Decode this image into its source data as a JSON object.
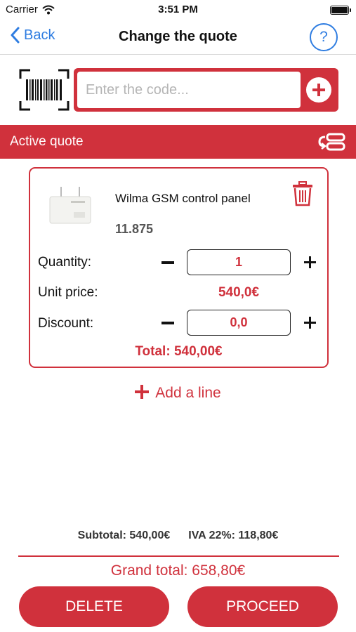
{
  "status_bar": {
    "carrier": "Carrier",
    "time": "3:51 PM"
  },
  "nav": {
    "back_label": "Back",
    "title": "Change the quote",
    "help_label": "?"
  },
  "code_entry": {
    "placeholder": "Enter the code..."
  },
  "section": {
    "title": "Active quote"
  },
  "quote_line": {
    "product_name": "Wilma GSM control panel",
    "product_code": "11.875",
    "quantity_label": "Quantity:",
    "quantity_value": "1",
    "unit_price_label": "Unit price:",
    "unit_price_value": "540,0€",
    "discount_label": "Discount:",
    "discount_value": "0,0",
    "total": "Total: 540,00€"
  },
  "add_line_label": "Add a line",
  "summary": {
    "subtotal": "Subtotal: 540,00€",
    "tax": "IVA 22%: 118,80€",
    "grand_total": "Grand total: 658,80€"
  },
  "actions": {
    "delete_label": "DELETE",
    "proceed_label": "PROCEED"
  },
  "colors": {
    "accent": "#d0313c",
    "link": "#2f7de1"
  },
  "icons": [
    "wifi-icon",
    "battery-icon",
    "chevron-left-icon",
    "barcode-icon",
    "plus-circle-icon",
    "switch-quote-icon",
    "trash-icon",
    "minus-icon",
    "plus-icon"
  ]
}
